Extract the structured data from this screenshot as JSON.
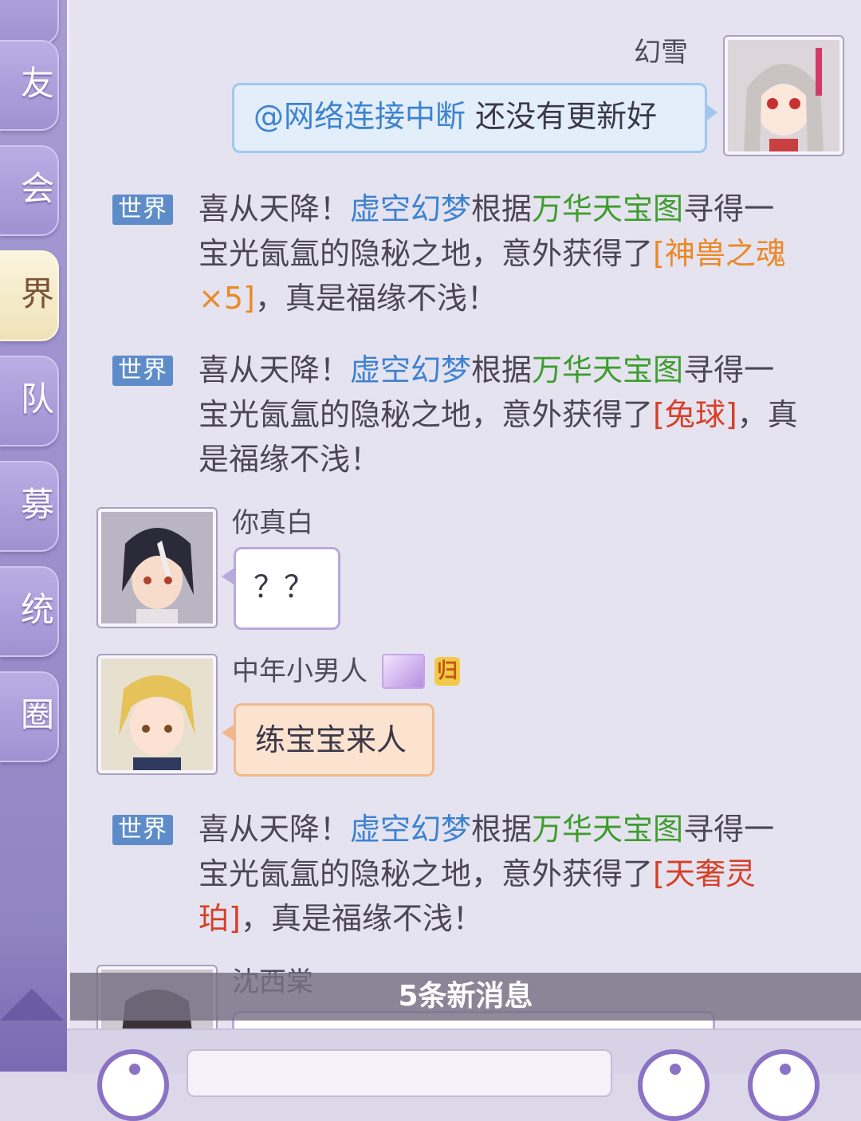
{
  "sidebar": {
    "tabs": [
      {
        "label": "友",
        "active": false
      },
      {
        "label": "会",
        "active": false
      },
      {
        "label": "界",
        "active": true
      },
      {
        "label": "队",
        "active": false
      },
      {
        "label": "募",
        "active": false
      },
      {
        "label": "统",
        "active": false
      },
      {
        "label": "圈",
        "active": false
      }
    ]
  },
  "messages": {
    "m1": {
      "sender": "幻雪",
      "text": "@网络连接中断  还没有更新好"
    },
    "sys1": {
      "channel": "世界",
      "prefix": "喜从天降！",
      "player": "虚空幻梦",
      "via": "根据",
      "map": "万华天宝图",
      "mid": "寻得一宝光氤氲的隐秘之地，意外获得了",
      "item": "[神兽之魂 ×5]",
      "suffix": "，真是福缘不浅！"
    },
    "sys2": {
      "channel": "世界",
      "prefix": "喜从天降！",
      "player": "虚空幻梦",
      "via": "根据",
      "map": "万华天宝图",
      "mid": "寻得一宝光氤氲的隐秘之地，意外获得了",
      "item": "[兔球]",
      "suffix": "，真是福缘不浅！"
    },
    "m2": {
      "sender": "你真白",
      "text": "？？"
    },
    "m3": {
      "sender": "中年小男人",
      "badge": "归",
      "text": "练宝宝来人"
    },
    "sys3": {
      "channel": "世界",
      "prefix": "喜从天降！",
      "player": "虚空幻梦",
      "via": "根据",
      "map": "万华天宝图",
      "mid": "寻得一宝光氤氲的隐秘之地，意外获得了",
      "item": "[天奢灵珀]",
      "suffix": "，真是福缘不浅！"
    },
    "m4": {
      "sender": "沈西棠"
    }
  },
  "new_messages_label": "5条新消息",
  "colors": {
    "player": "#3e83cf",
    "map": "#3d9e2c",
    "item_orange": "#e98a26",
    "item_red": "#d64026",
    "world_badge": "#5d8cc9"
  }
}
